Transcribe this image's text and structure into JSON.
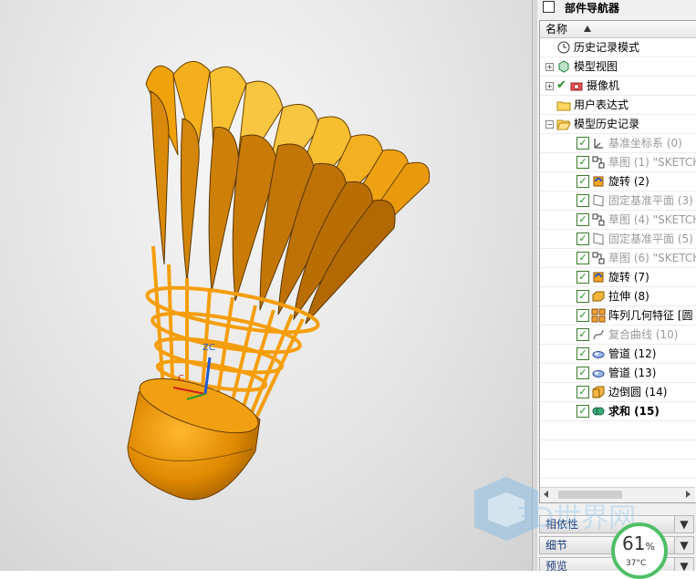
{
  "navigator": {
    "title": "部件导航器",
    "column_header": "名称",
    "items": [
      {
        "label": "历史记录模式",
        "icon": "clock-icon",
        "style": "normal"
      },
      {
        "label": "模型视图",
        "icon": "model-view-icon",
        "style": "normal"
      },
      {
        "label": "摄像机",
        "icon": "camera-icon",
        "style": "normal"
      },
      {
        "label": "用户表达式",
        "icon": "folder-icon",
        "style": "normal"
      },
      {
        "label": "模型历史记录",
        "icon": "folder-open-icon",
        "style": "normal"
      },
      {
        "label": "基准坐标系 (0)",
        "icon": "datum-csys-icon",
        "style": "dim"
      },
      {
        "label": "草图 (1) \"SKETCH",
        "icon": "sketch-icon",
        "style": "dim"
      },
      {
        "label": "旋转 (2)",
        "icon": "revolve-icon",
        "style": "normal"
      },
      {
        "label": "固定基准平面 (3)",
        "icon": "datum-plane-icon",
        "style": "dim"
      },
      {
        "label": "草图 (4) \"SKETCH",
        "icon": "sketch-icon",
        "style": "dim"
      },
      {
        "label": "固定基准平面 (5)",
        "icon": "datum-plane-icon",
        "style": "dim"
      },
      {
        "label": "草图 (6) \"SKETCH",
        "icon": "sketch-icon",
        "style": "dim"
      },
      {
        "label": "旋转 (7)",
        "icon": "revolve-icon",
        "style": "normal"
      },
      {
        "label": "拉伸 (8)",
        "icon": "extrude-icon",
        "style": "normal"
      },
      {
        "label": "阵列几何特征 [圆",
        "icon": "pattern-icon",
        "style": "normal"
      },
      {
        "label": "复合曲线 (10)",
        "icon": "curve-icon",
        "style": "dim"
      },
      {
        "label": "管道 (12)",
        "icon": "tube-icon",
        "style": "normal"
      },
      {
        "label": "管道 (13)",
        "icon": "tube-icon",
        "style": "normal"
      },
      {
        "label": "边倒圆 (14)",
        "icon": "edge-blend-icon",
        "style": "normal"
      },
      {
        "label": "求和 (15)",
        "icon": "unite-icon",
        "style": "bold"
      }
    ]
  },
  "panels": [
    {
      "label": "相依性"
    },
    {
      "label": "细节"
    },
    {
      "label": "预览"
    }
  ],
  "gauge": {
    "percent": "61",
    "unit": "%",
    "temp": "37°C",
    "level": 0.61
  },
  "viewport": {
    "csys_label": "ZC",
    "csys_label2": "C"
  },
  "watermark": {
    "text": "3D世界网"
  },
  "colors": {
    "shuttle_orange": "#f2a20c",
    "feather_dark": "#b5770a",
    "check_green": "#1f8f1f"
  }
}
